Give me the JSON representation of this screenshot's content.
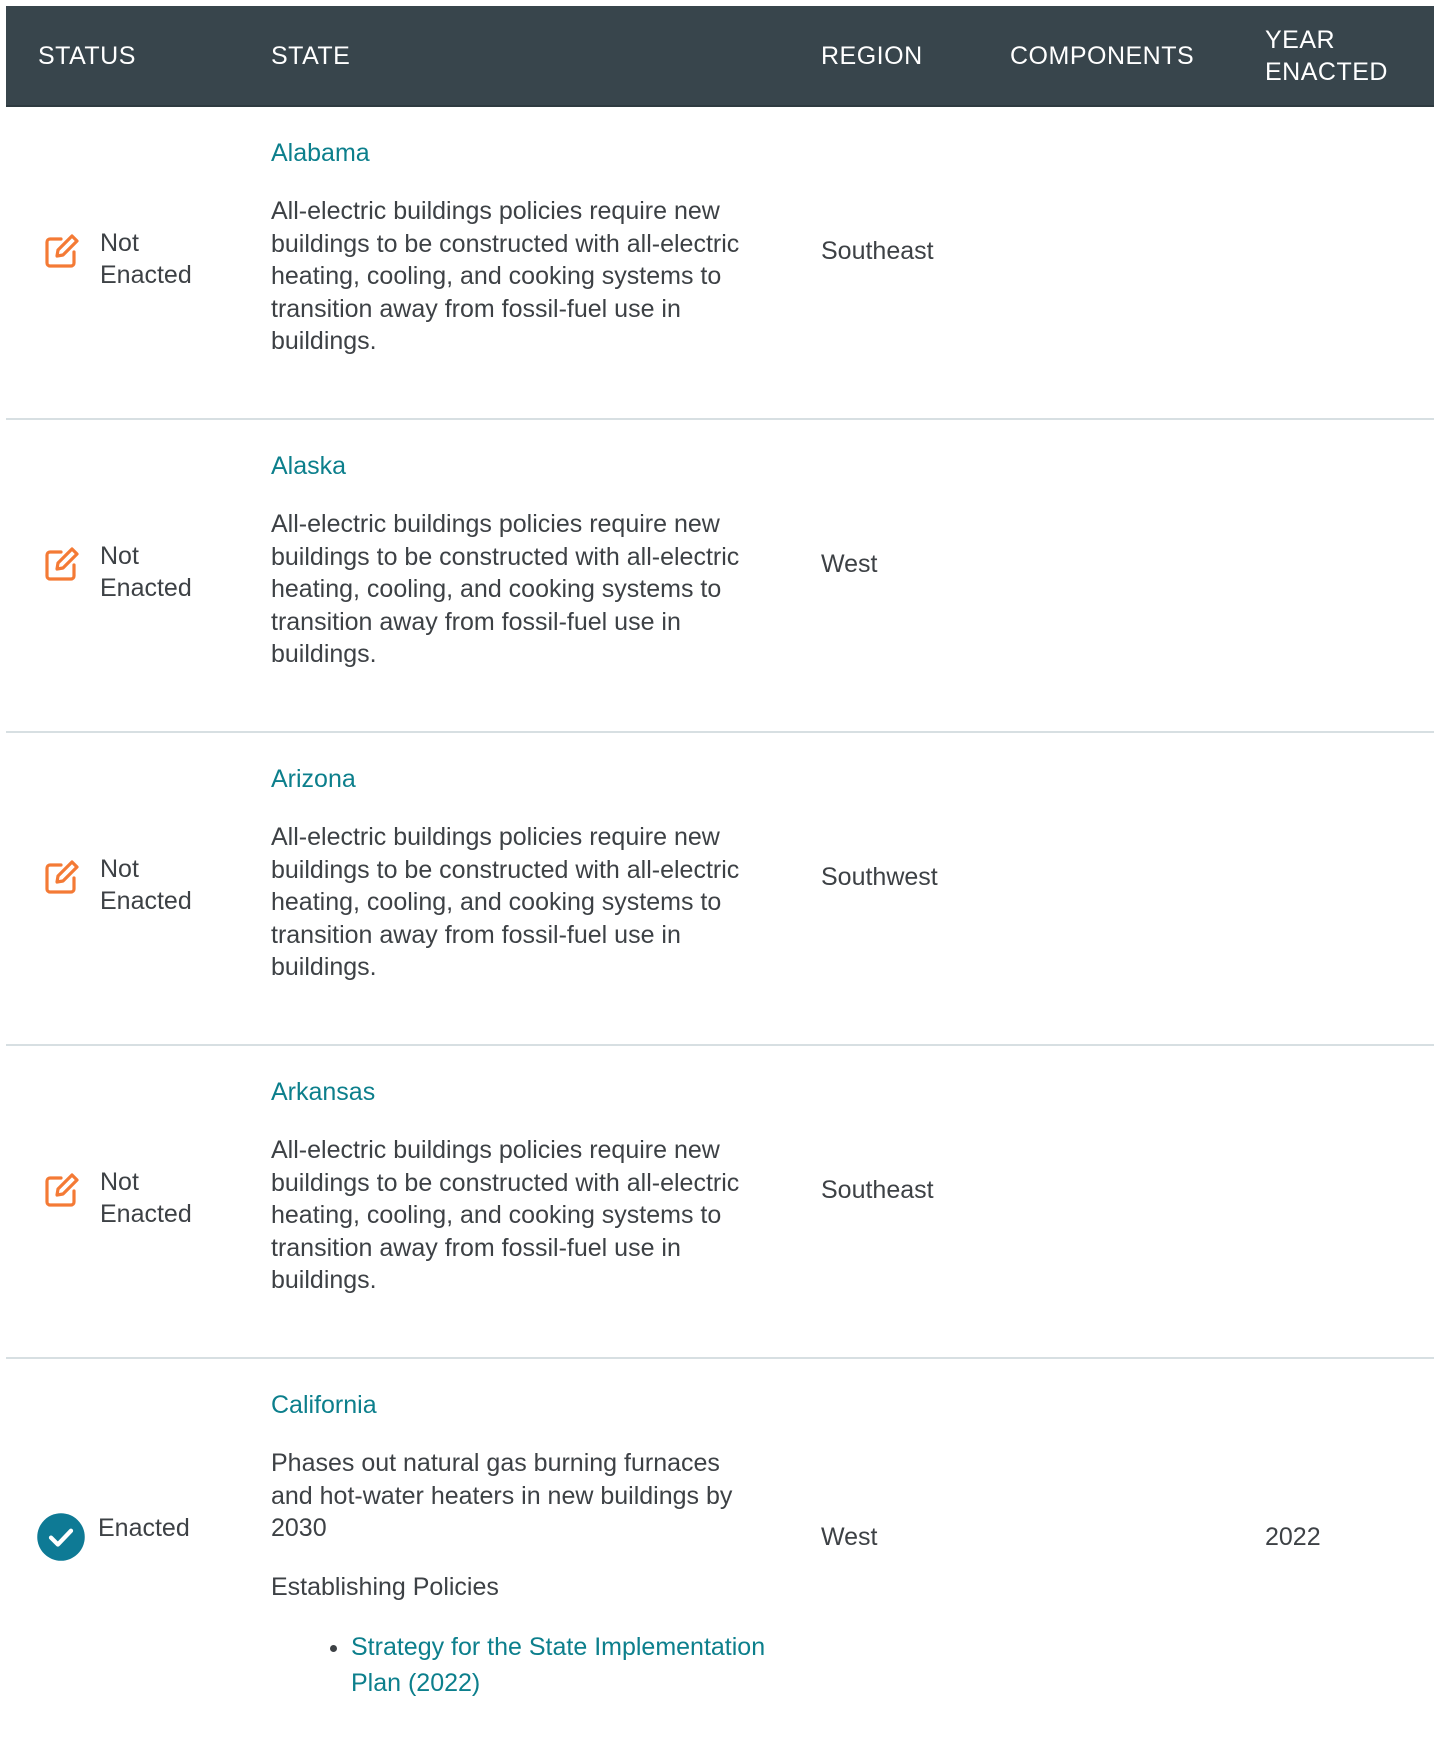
{
  "columns": {
    "status": "STATUS",
    "state": "STATE",
    "region": "REGION",
    "components": "COMPONENTS",
    "year_line1": "YEAR",
    "year_line2": "ENACTED"
  },
  "colors": {
    "header_bg": "#38454c",
    "link": "#0c7f8c",
    "not_enacted_icon": "#f47a35",
    "enacted_icon": "#0e7a95"
  },
  "rows": [
    {
      "status_icon": "edit-icon",
      "status_line1": "Not",
      "status_line2": "Enacted",
      "state": "Alabama",
      "description": "All-electric buildings policies require new buildings to be constructed with all-electric heating, cooling, and cooking systems to transition away from fossil-fuel use in buildings.",
      "region": "Southeast",
      "year": ""
    },
    {
      "status_icon": "edit-icon",
      "status_line1": "Not",
      "status_line2": "Enacted",
      "state": "Alaska",
      "description": "All-electric buildings policies require new buildings to be constructed with all-electric heating, cooling, and cooking systems to transition away from fossil-fuel use in buildings.",
      "region": "West",
      "year": ""
    },
    {
      "status_icon": "edit-icon",
      "status_line1": "Not",
      "status_line2": "Enacted",
      "state": "Arizona",
      "description": "All-electric buildings policies require new buildings to be constructed with all-electric heating, cooling, and cooking systems to transition away from fossil-fuel use in buildings.",
      "region": "Southwest",
      "year": ""
    },
    {
      "status_icon": "edit-icon",
      "status_line1": "Not",
      "status_line2": "Enacted",
      "state": "Arkansas",
      "description": "All-electric buildings policies require new buildings to be constructed with all-electric heating, cooling, and cooking systems to transition away from fossil-fuel use in buildings.",
      "region": "Southeast",
      "year": ""
    },
    {
      "status_icon": "check-circle-icon",
      "status_line1": "Enacted",
      "state": "California",
      "description": "Phases out natural gas burning furnaces and hot-water heaters in new buildings by 2030",
      "establishing_title": "Establishing Policies",
      "establishing_links": [
        "Strategy for the State Implementation Plan (2022)"
      ],
      "region": "West",
      "year": "2022"
    }
  ]
}
